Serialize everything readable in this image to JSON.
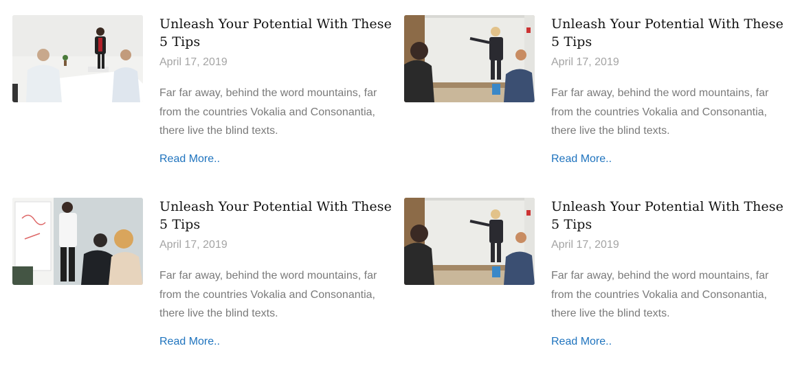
{
  "posts": [
    {
      "title": "Unleash Your Potential With These 5 Tips",
      "date": "April 17, 2019",
      "excerpt": "Far far away, behind the word mountains, far from the countries Vokalia and Consonantia, there live the blind texts.",
      "read_more": "Read More.."
    },
    {
      "title": "Unleash Your Potential With These 5 Tips",
      "date": "April 17, 2019",
      "excerpt": "Far far away, behind the word mountains, far from the countries Vokalia and Consonantia, there live the blind texts.",
      "read_more": "Read More.."
    },
    {
      "title": "Unleash Your Potential With These 5 Tips",
      "date": "April 17, 2019",
      "excerpt": "Far far away, behind the word mountains, far from the countries Vokalia and Consonantia, there live the blind texts.",
      "read_more": "Read More.."
    },
    {
      "title": "Unleash Your Potential With These 5 Tips",
      "date": "April 17, 2019",
      "excerpt": "Far far away, behind the word mountains, far from the countries Vokalia and Consonantia, there live the blind texts.",
      "read_more": "Read More.."
    }
  ],
  "colors": {
    "title": "#111111",
    "date": "#a4a4a4",
    "excerpt": "#7a7a7a",
    "link": "#1e73be"
  }
}
